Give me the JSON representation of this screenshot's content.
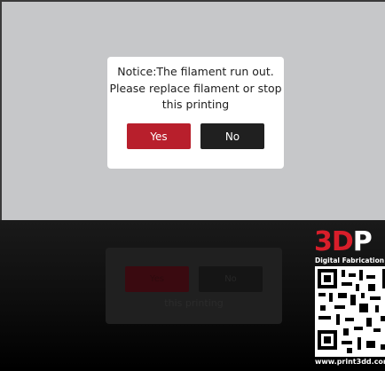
{
  "dialog": {
    "message_lines": [
      "Notice:The filament run out.",
      "Please replace filament or stop",
      "this printing"
    ],
    "yes_label": "Yes",
    "no_label": "No"
  },
  "reflection": {
    "yes_label": "Yes",
    "no_label": "No",
    "text": "this printing"
  },
  "watermark": {
    "logo_text": "3D",
    "logo_partial": "P",
    "tagline": "Digital Fabrication",
    "url": "www.print3dd.com",
    "icon": "qr-code-icon"
  },
  "colors": {
    "screen_bg": "#c6c7c9",
    "yes_button": "#b81f2c",
    "no_button": "#202020",
    "brand_red": "#d81e2a"
  }
}
